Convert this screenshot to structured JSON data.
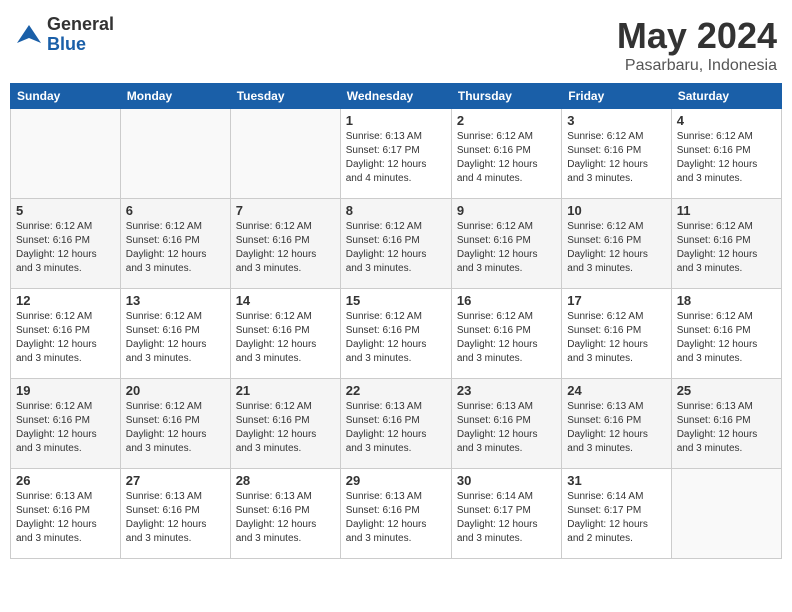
{
  "header": {
    "logo_general": "General",
    "logo_blue": "Blue",
    "month_title": "May 2024",
    "location": "Pasarbaru, Indonesia"
  },
  "days_of_week": [
    "Sunday",
    "Monday",
    "Tuesday",
    "Wednesday",
    "Thursday",
    "Friday",
    "Saturday"
  ],
  "weeks": [
    [
      {
        "day": "",
        "info": ""
      },
      {
        "day": "",
        "info": ""
      },
      {
        "day": "",
        "info": ""
      },
      {
        "day": "1",
        "info": "Sunrise: 6:13 AM\nSunset: 6:17 PM\nDaylight: 12 hours\nand 4 minutes."
      },
      {
        "day": "2",
        "info": "Sunrise: 6:12 AM\nSunset: 6:16 PM\nDaylight: 12 hours\nand 4 minutes."
      },
      {
        "day": "3",
        "info": "Sunrise: 6:12 AM\nSunset: 6:16 PM\nDaylight: 12 hours\nand 3 minutes."
      },
      {
        "day": "4",
        "info": "Sunrise: 6:12 AM\nSunset: 6:16 PM\nDaylight: 12 hours\nand 3 minutes."
      }
    ],
    [
      {
        "day": "5",
        "info": "Sunrise: 6:12 AM\nSunset: 6:16 PM\nDaylight: 12 hours\nand 3 minutes."
      },
      {
        "day": "6",
        "info": "Sunrise: 6:12 AM\nSunset: 6:16 PM\nDaylight: 12 hours\nand 3 minutes."
      },
      {
        "day": "7",
        "info": "Sunrise: 6:12 AM\nSunset: 6:16 PM\nDaylight: 12 hours\nand 3 minutes."
      },
      {
        "day": "8",
        "info": "Sunrise: 6:12 AM\nSunset: 6:16 PM\nDaylight: 12 hours\nand 3 minutes."
      },
      {
        "day": "9",
        "info": "Sunrise: 6:12 AM\nSunset: 6:16 PM\nDaylight: 12 hours\nand 3 minutes."
      },
      {
        "day": "10",
        "info": "Sunrise: 6:12 AM\nSunset: 6:16 PM\nDaylight: 12 hours\nand 3 minutes."
      },
      {
        "day": "11",
        "info": "Sunrise: 6:12 AM\nSunset: 6:16 PM\nDaylight: 12 hours\nand 3 minutes."
      }
    ],
    [
      {
        "day": "12",
        "info": "Sunrise: 6:12 AM\nSunset: 6:16 PM\nDaylight: 12 hours\nand 3 minutes."
      },
      {
        "day": "13",
        "info": "Sunrise: 6:12 AM\nSunset: 6:16 PM\nDaylight: 12 hours\nand 3 minutes."
      },
      {
        "day": "14",
        "info": "Sunrise: 6:12 AM\nSunset: 6:16 PM\nDaylight: 12 hours\nand 3 minutes."
      },
      {
        "day": "15",
        "info": "Sunrise: 6:12 AM\nSunset: 6:16 PM\nDaylight: 12 hours\nand 3 minutes."
      },
      {
        "day": "16",
        "info": "Sunrise: 6:12 AM\nSunset: 6:16 PM\nDaylight: 12 hours\nand 3 minutes."
      },
      {
        "day": "17",
        "info": "Sunrise: 6:12 AM\nSunset: 6:16 PM\nDaylight: 12 hours\nand 3 minutes."
      },
      {
        "day": "18",
        "info": "Sunrise: 6:12 AM\nSunset: 6:16 PM\nDaylight: 12 hours\nand 3 minutes."
      }
    ],
    [
      {
        "day": "19",
        "info": "Sunrise: 6:12 AM\nSunset: 6:16 PM\nDaylight: 12 hours\nand 3 minutes."
      },
      {
        "day": "20",
        "info": "Sunrise: 6:12 AM\nSunset: 6:16 PM\nDaylight: 12 hours\nand 3 minutes."
      },
      {
        "day": "21",
        "info": "Sunrise: 6:12 AM\nSunset: 6:16 PM\nDaylight: 12 hours\nand 3 minutes."
      },
      {
        "day": "22",
        "info": "Sunrise: 6:13 AM\nSunset: 6:16 PM\nDaylight: 12 hours\nand 3 minutes."
      },
      {
        "day": "23",
        "info": "Sunrise: 6:13 AM\nSunset: 6:16 PM\nDaylight: 12 hours\nand 3 minutes."
      },
      {
        "day": "24",
        "info": "Sunrise: 6:13 AM\nSunset: 6:16 PM\nDaylight: 12 hours\nand 3 minutes."
      },
      {
        "day": "25",
        "info": "Sunrise: 6:13 AM\nSunset: 6:16 PM\nDaylight: 12 hours\nand 3 minutes."
      }
    ],
    [
      {
        "day": "26",
        "info": "Sunrise: 6:13 AM\nSunset: 6:16 PM\nDaylight: 12 hours\nand 3 minutes."
      },
      {
        "day": "27",
        "info": "Sunrise: 6:13 AM\nSunset: 6:16 PM\nDaylight: 12 hours\nand 3 minutes."
      },
      {
        "day": "28",
        "info": "Sunrise: 6:13 AM\nSunset: 6:16 PM\nDaylight: 12 hours\nand 3 minutes."
      },
      {
        "day": "29",
        "info": "Sunrise: 6:13 AM\nSunset: 6:16 PM\nDaylight: 12 hours\nand 3 minutes."
      },
      {
        "day": "30",
        "info": "Sunrise: 6:14 AM\nSunset: 6:17 PM\nDaylight: 12 hours\nand 3 minutes."
      },
      {
        "day": "31",
        "info": "Sunrise: 6:14 AM\nSunset: 6:17 PM\nDaylight: 12 hours\nand 2 minutes."
      },
      {
        "day": "",
        "info": ""
      }
    ]
  ]
}
